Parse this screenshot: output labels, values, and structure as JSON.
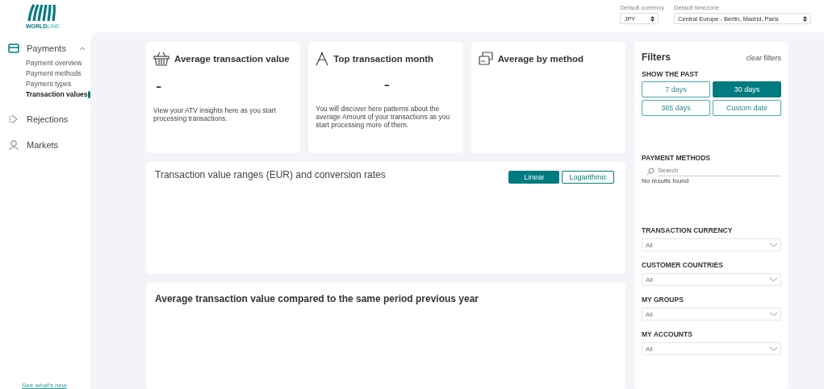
{
  "logo": {
    "parts": [
      "WORLD",
      "LINE"
    ]
  },
  "header": {
    "currency": {
      "label": "Default currency",
      "value": "JPY"
    },
    "timezone": {
      "label": "Default timezone",
      "value": "Central Europe - Berlin, Madrid, Paris"
    }
  },
  "sidebar": {
    "items": [
      {
        "label": "Payments",
        "kind": "card",
        "expanded": true,
        "children": [
          {
            "label": "Payment overview",
            "selected": false
          },
          {
            "label": "Payment methods",
            "selected": false
          },
          {
            "label": "Payment types",
            "selected": false
          },
          {
            "label": "Transaction values",
            "selected": true
          }
        ]
      },
      {
        "label": "Rejections",
        "kind": "reject"
      },
      {
        "label": "Markets",
        "kind": "person"
      }
    ],
    "footer_link": "See what's new"
  },
  "kpi_cards": [
    {
      "title": "Average transaction value",
      "kind": "basket",
      "value": "-",
      "text": "View your ATV insights here as you start processing transactions."
    },
    {
      "title": "Top transaction month",
      "kind": "compass",
      "value": "-",
      "text": "You will discover here patterns about the average Amount of your transactions as you start processing more of them."
    },
    {
      "title": "Average by method",
      "kind": "cards"
    }
  ],
  "range_chart": {
    "title": "Transaction value ranges (EUR) and conversion rates",
    "scales": [
      {
        "label": "Linear",
        "selected": true
      },
      {
        "label": "Logarithmic",
        "selected": false
      }
    ]
  },
  "comparison": {
    "title": "Average transaction value compared to the same period previous year"
  },
  "filters": {
    "title": "Filters",
    "clear": "clear filters",
    "period_label": "SHOW THE PAST",
    "periods": [
      {
        "label": "7 days",
        "selected": false
      },
      {
        "label": "30 days",
        "selected": true
      },
      {
        "label": "365 days",
        "selected": false
      },
      {
        "label": "Custom date",
        "selected": false
      }
    ],
    "payment_methods": {
      "label": "PAYMENT METHODS",
      "placeholder": "Search",
      "empty": "No results found"
    },
    "selects": [
      {
        "label": "TRANSACTION CURRENCY",
        "value": "All"
      },
      {
        "label": "CUSTOMER COUNTRIES",
        "value": "All"
      },
      {
        "label": "MY GROUPS",
        "value": "All"
      },
      {
        "label": "MY ACCOUNTS",
        "value": "All"
      }
    ]
  }
}
